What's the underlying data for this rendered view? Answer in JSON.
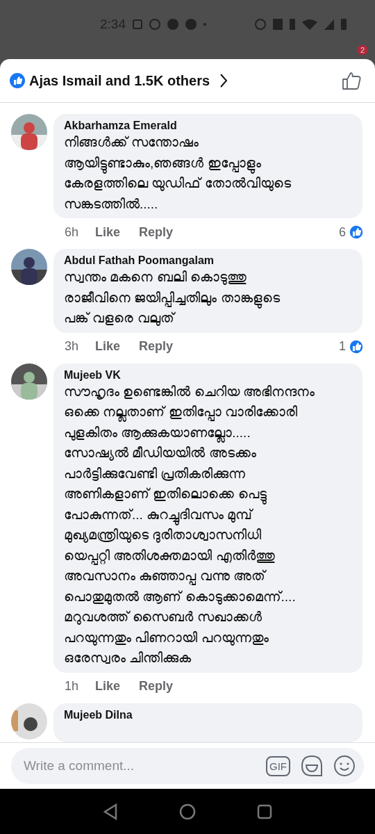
{
  "status_bar": {
    "time": "2:34"
  },
  "background": {
    "badge": "2"
  },
  "sheet_header": {
    "reactions_summary": "Ajas Ismail and 1.5K others"
  },
  "comments": [
    {
      "author": "Akbarhamza Emerald",
      "lines": [
        "നിങ്ങൾക്ക് സന്തോഷം",
        "ആയിട്ടുണ്ടാകും,ഞങ്ങൾ ഇപ്പോളും",
        "കേരളത്തിലെ യുഡിഫ് തോൽവിയുടെ",
        "സങ്കടത്തിൽ....."
      ],
      "time": "6h",
      "like": "Like",
      "reply": "Reply",
      "reactions": "6"
    },
    {
      "author": "Abdul Fathah Poomangalam",
      "lines": [
        "സ്വന്തം മകനെ ബലി കൊടുത്തു",
        "രാജീവിനെ ജയിപ്പിച്ചതിലും താങ്കളുടെ",
        "പങ്ക് വളരെ വലുത്"
      ],
      "time": "3h",
      "like": "Like",
      "reply": "Reply",
      "reactions": "1"
    },
    {
      "author": "Mujeeb VK",
      "lines": [
        "സൗഹൃദം ഉണ്ടെങ്കിൽ ചെറിയ അഭിനന്ദനം",
        "ഒക്കെ നല്ലതാണ് ഇതിപ്പോ വാരിക്കോരി",
        "പുളകിതം ആക്കുകയാണല്ലോ.....",
        "സോഷ്യൽ മീഡിയയിൽ അടക്കം",
        "പാർട്ടിക്കുവേണ്ടി പ്രതികരിക്കുന്ന",
        "അണികളാണ് ഇതിലൊക്കെ പെട്ടു",
        "പോകുന്നത്... കുറച്ചുദിവസം മുമ്പ്",
        "മുഖ്യമന്ത്രിയുടെ ദുരിതാശ്വാസനിധി",
        "യെപ്പറ്റി അതിശക്തമായി എതിർത്തു",
        "അവസാനം കുഞ്ഞാപ്പ വന്നു അത്",
        "പൊതുമുതൽ ആണ് കൊടുക്കാമെന്ന്....",
        "മറുവശത്ത് സൈബർ സഖാക്കൾ",
        "പറയുന്നതും പിണറായി പറയുന്നതും",
        "ഒരേസ്വരം ചിന്തിക്കുക"
      ],
      "time": "1h",
      "like": "Like",
      "reply": "Reply"
    }
  ],
  "partial_comment": {
    "author": "Mujeeb Dilna"
  },
  "composer": {
    "placeholder": "Write a comment...",
    "gif": "GIF"
  }
}
